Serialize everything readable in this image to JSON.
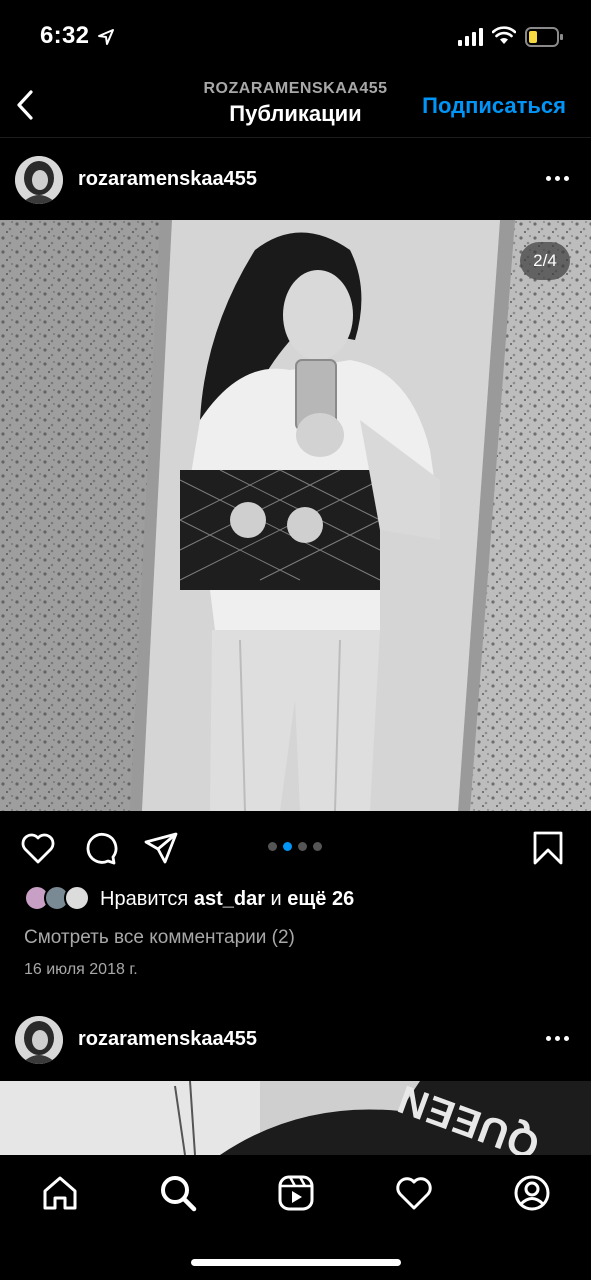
{
  "status_bar": {
    "time": "6:32",
    "icons": [
      "location-arrow-icon",
      "cellular-signal-icon",
      "wifi-icon",
      "battery-icon"
    ],
    "battery_color": "#f5d742"
  },
  "header": {
    "username": "ROZARAMENSKAA455",
    "title": "Публикации",
    "follow_label": "Подписаться",
    "accent_color": "#0095f6"
  },
  "posts": [
    {
      "username": "rozaramenskaa455",
      "page_indicator": "2/4",
      "carousel": {
        "total": 4,
        "active": 2
      },
      "likes_prefix": "Нравится",
      "likes_user": "ast_dar",
      "likes_and": "и",
      "likes_rest": "ещё 26",
      "view_comments": "Смотреть все комментарии (2)",
      "date": "16 июля 2018 г."
    },
    {
      "username": "rozaramenskaa455",
      "photo_text": "QUEEN"
    }
  ],
  "tab_bar": {
    "items": [
      "home-icon",
      "search-icon",
      "reels-icon",
      "heart-icon",
      "profile-icon"
    ],
    "active": "search-icon"
  }
}
